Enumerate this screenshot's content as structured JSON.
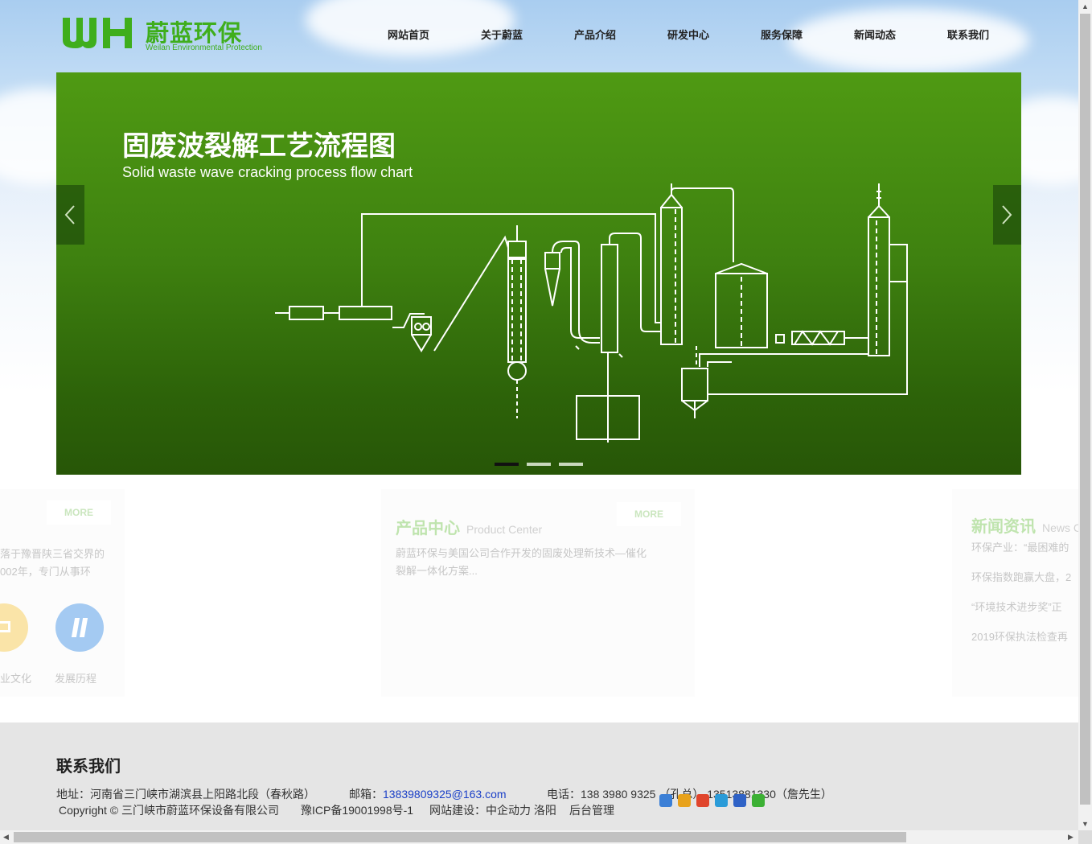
{
  "brand": {
    "logo_mark_text": "WH",
    "name_cn": "蔚蓝环保",
    "name_en": "Weilan Environmental Protection",
    "color": "#3fae1c"
  },
  "nav": {
    "items": [
      "网站首页",
      "关于蔚蓝",
      "产品介绍",
      "研发中心",
      "服务保障",
      "新闻动态",
      "联系我们"
    ]
  },
  "slider": {
    "title": "固废波裂解工艺流程图",
    "subtitle": "Solid waste wave cracking process flow chart",
    "slide_count": 3,
    "active_index": 0
  },
  "panels": {
    "about": {
      "more": "MORE",
      "lines": [
        "落于豫晋陕三省交界的",
        "002年，专门从事环"
      ],
      "icons": [
        {
          "icon": "culture-icon",
          "label": "业文化",
          "color": "#f6cf62"
        },
        {
          "icon": "history-icon",
          "label": "发展历程",
          "color": "#5aa0e8"
        }
      ]
    },
    "products": {
      "more": "MORE",
      "title": "产品中心",
      "title_en": "Product Center",
      "lines": [
        "蔚蓝环保与美国公司合作开发的固废处理新技术—催化",
        "裂解一体化方案..."
      ]
    },
    "news": {
      "title": "新闻资讯",
      "title_en": "News C",
      "items": [
        "环保产业：“最困难的",
        "环保指数跑赢大盘，2",
        "“环境技术进步奖”正",
        "2019环保执法检查再"
      ]
    }
  },
  "footer": {
    "title": "联系我们",
    "address": "地址：河南省三门峡市湖滨县上阳路北段（春秋路）",
    "email_label": "邮箱：",
    "email": "13839809325@163.com",
    "phone": "电话：138 3980 9325 （孔总） 13513881330（詹先生）",
    "copyright": "Copyright © 三门峡市蔚蓝环保设备有限公司",
    "icp": "豫ICP备19001998号-1",
    "builder": "网站建设：中企动力 洛阳",
    "admin": "后台管理",
    "share_colors": [
      "#3b7fd6",
      "#e8a21b",
      "#e0452c",
      "#2a9bd8",
      "#2f62c6",
      "#3cb034"
    ]
  }
}
